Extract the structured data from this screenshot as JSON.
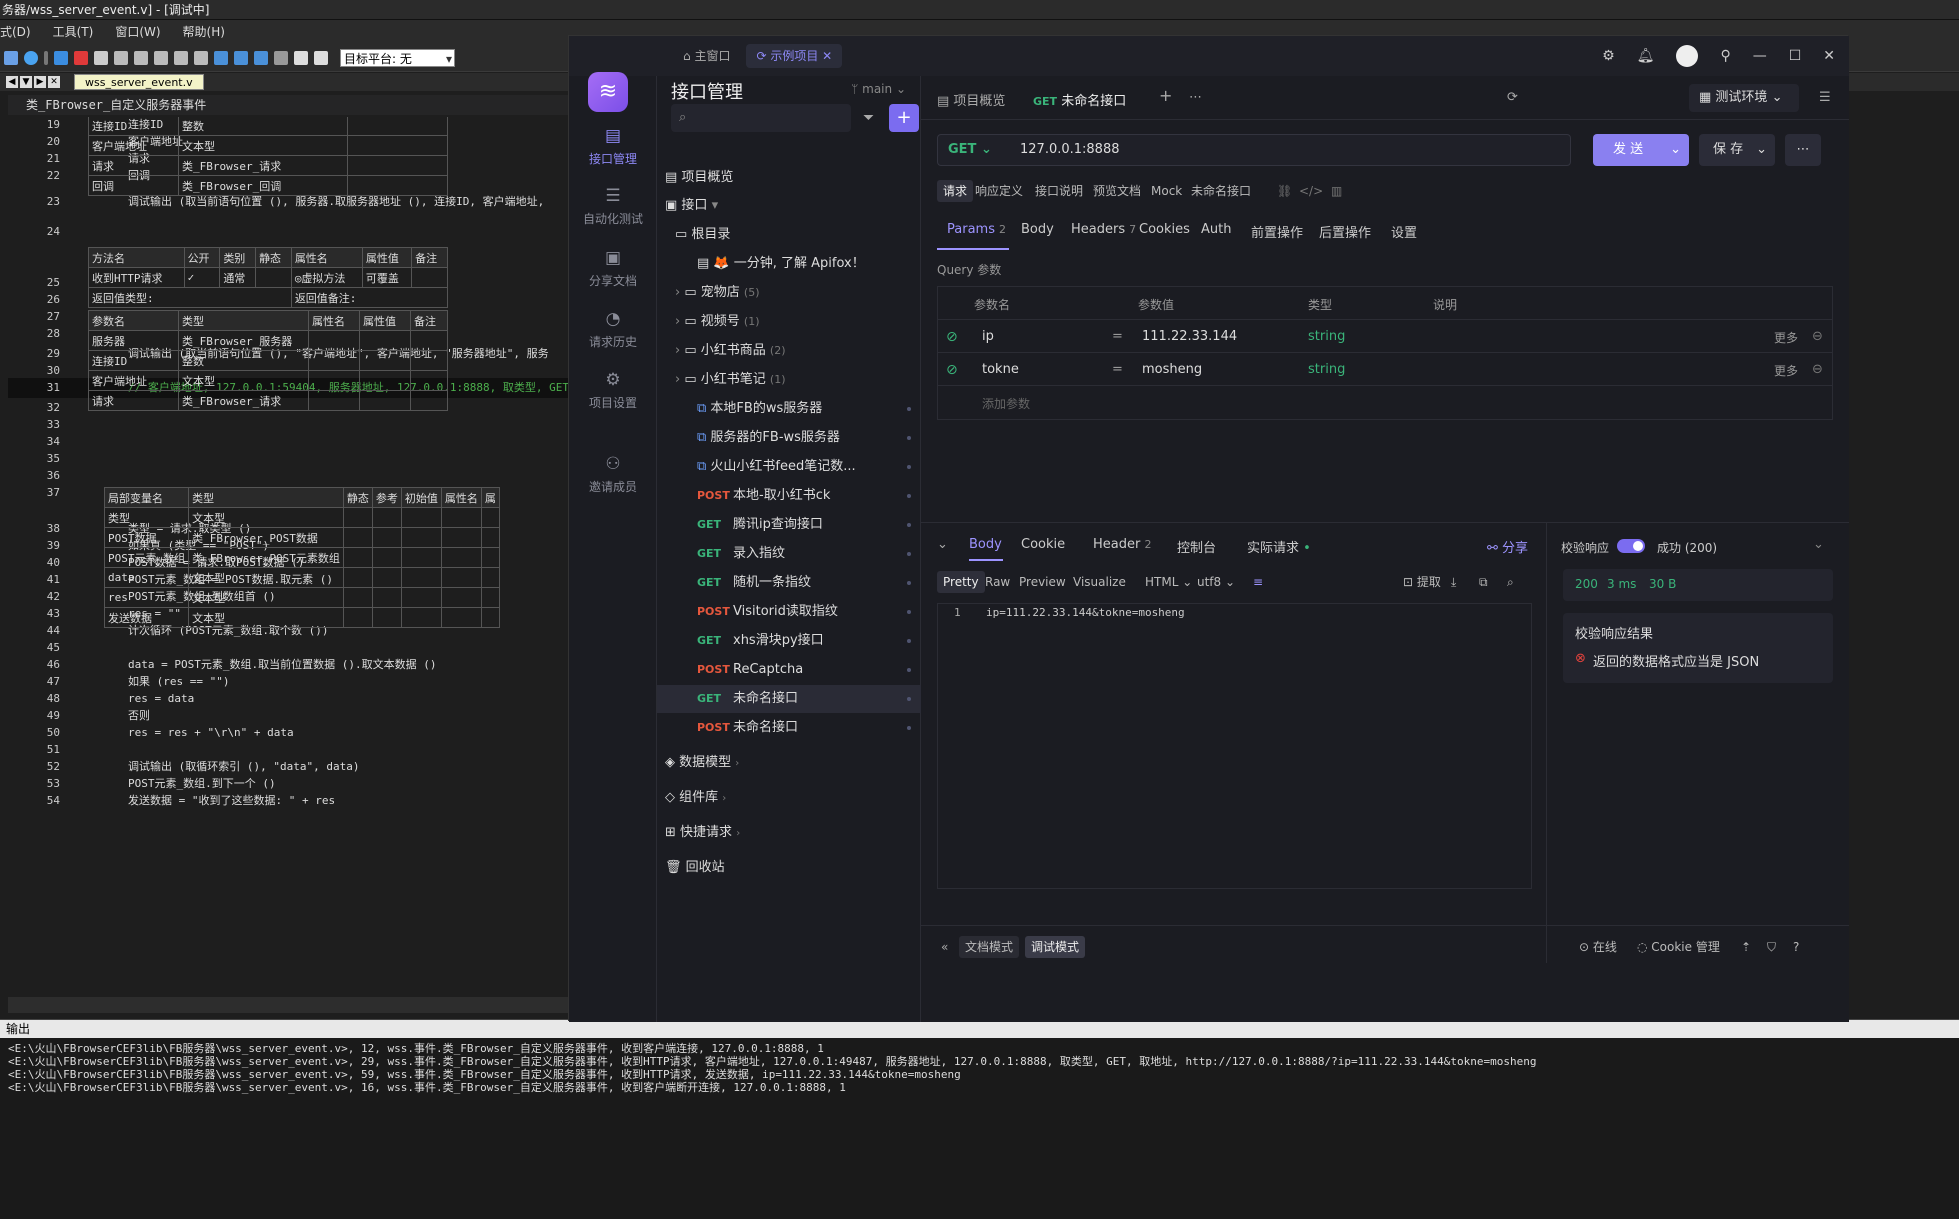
{
  "ide": {
    "title": "务器/wss_server_event.v] - [调试中]",
    "menu": [
      "式(D)",
      "工具(T)",
      "窗口(W)",
      "帮助(H)"
    ],
    "target_platform": "目标平台: 无",
    "file_tab": "wss_server_event.v",
    "sub_header": "类_FBrowser_自定义服务器事件",
    "lines": [
      {
        "n": "19",
        "text": "连接ID"
      },
      {
        "n": "20",
        "text": "客户端地址"
      },
      {
        "n": "21",
        "text": "请求"
      },
      {
        "n": "22",
        "text": "回调"
      },
      {
        "n": "23",
        "text": "调试输出 (取当前语句位置 (), 服务器.取服务器地址 (), 连接ID, 客户端地址,"
      },
      {
        "n": "24",
        "text": ""
      },
      {
        "n": "25",
        "text": ""
      },
      {
        "n": "26",
        "text": ""
      },
      {
        "n": "27",
        "text": ""
      },
      {
        "n": "28",
        "text": ""
      },
      {
        "n": "29",
        "text": "调试输出 (取当前语句位置 (), \"客户端地址\", 客户端地址, \"服务器地址\", 服务"
      },
      {
        "n": "30",
        "text": ""
      },
      {
        "n": "31",
        "text": "// 客户端地址, 127.0.0.1:59404, 服务器地址, 127.0.0.1:8888, 取类型, GET,"
      },
      {
        "n": "32",
        "text": ""
      },
      {
        "n": "33",
        "text": ""
      },
      {
        "n": "34",
        "text": ""
      },
      {
        "n": "35",
        "text": ""
      },
      {
        "n": "36",
        "text": ""
      },
      {
        "n": "37",
        "text": ""
      },
      {
        "n": "38",
        "text": "类型 = 请求.取类型 ()"
      },
      {
        "n": "39",
        "text": "如果真 (类型 == \"POST\")"
      },
      {
        "n": "40",
        "text": "  POST数据 = 请求.取POST数据 ()"
      },
      {
        "n": "41",
        "text": "  POST元素_数组 = POST数据.取元素 ()"
      },
      {
        "n": "42",
        "text": "  POST元素_数组.到数组首 ()"
      },
      {
        "n": "43",
        "text": "  res = \"\""
      },
      {
        "n": "44",
        "text": "  计次循环 (POST元素_数组.取个数 ())"
      },
      {
        "n": "45",
        "text": ""
      },
      {
        "n": "46",
        "text": "    data = POST元素_数组.取当前位置数据 ().取文本数据 ()"
      },
      {
        "n": "47",
        "text": "    如果 (res == \"\")"
      },
      {
        "n": "48",
        "text": "      res = data"
      },
      {
        "n": "49",
        "text": "    否则"
      },
      {
        "n": "50",
        "text": "      res = res + \"\\r\\n\" + data"
      },
      {
        "n": "51",
        "text": ""
      },
      {
        "n": "52",
        "text": "    调试输出 (取循环索引 (), \"data\", data)"
      },
      {
        "n": "53",
        "text": "    POST元素_数组.到下一个 ()"
      },
      {
        "n": "54",
        "text": "  发送数据 = \"收到了这些数据: \" + res"
      }
    ],
    "params_table": [
      [
        "连接ID",
        "整数"
      ],
      [
        "客户端地址",
        "文本型"
      ],
      [
        "请求",
        "类_FBrowser_请求"
      ],
      [
        "回调",
        "类_FBrowser_回调"
      ]
    ],
    "method_table": {
      "headers": [
        "方法名",
        "公开",
        "类别",
        "静态",
        "属性名",
        "属性值",
        "备注"
      ],
      "row": [
        "收到HTTP请求",
        "✓",
        "通常",
        "",
        "◎虚拟方法",
        "可覆盖",
        ""
      ],
      "return_type": "返回值类型:",
      "return_note": "返回值备注:"
    },
    "param_table2": {
      "headers": [
        "参数名",
        "类型",
        "属性名",
        "属性值",
        "备注"
      ],
      "rows": [
        [
          "服务器",
          "类_FBrowser_服务器"
        ],
        [
          "连接ID",
          "整数"
        ],
        [
          "客户端地址",
          "文本型"
        ],
        [
          "请求",
          "类_FBrowser_请求"
        ]
      ]
    },
    "local_table": {
      "headers": [
        "局部变量名",
        "类型",
        "静态",
        "参考",
        "初始值",
        "属性名",
        "属"
      ],
      "rows": [
        [
          "类型",
          "文本型"
        ],
        [
          "POST数据",
          "类_FBrowser_POST数据"
        ],
        [
          "POST元素_数组",
          "类_FBrowser_POST元素数组"
        ],
        [
          "data",
          "文本型"
        ],
        [
          "res",
          "文本型"
        ],
        [
          "发送数据",
          "文本型"
        ]
      ]
    },
    "output_title": "输出",
    "output_lines": [
      "<E:\\火山\\FBrowserCEF3lib\\FB服务器\\wss_server_event.v>, 12, wss.事件.类_FBrowser_自定义服务器事件, 收到客户端连接, 127.0.0.1:8888, 1",
      "<E:\\火山\\FBrowserCEF3lib\\FB服务器\\wss_server_event.v>, 29, wss.事件.类_FBrowser_自定义服务器事件, 收到HTTP请求, 客户端地址, 127.0.0.1:49487, 服务器地址, 127.0.0.1:8888, 取类型, GET, 取地址, http://127.0.0.1:8888/?ip=111.22.33.144&tokne=mosheng",
      "<E:\\火山\\FBrowserCEF3lib\\FB服务器\\wss_server_event.v>, 59, wss.事件.类_FBrowser_自定义服务器事件, 收到HTTP请求, 发送数据, ip=111.22.33.144&tokne=mosheng",
      "<E:\\火山\\FBrowserCEF3lib\\FB服务器\\wss_server_event.v>, 16, wss.事件.类_FBrowser_自定义服务器事件, 收到客户端断开连接, 127.0.0.1:8888, 1"
    ]
  },
  "apifox": {
    "window_tabs": [
      "主窗口",
      "示例项目"
    ],
    "rail": [
      "接口管理",
      "自动化测试",
      "分享文档",
      "请求历史",
      "项目设置",
      "邀请成员"
    ],
    "panel_title": "接口管理",
    "branch": "main",
    "tree": {
      "overview": "项目概览",
      "api_folder": "接口",
      "root": "根目录",
      "items": [
        {
          "label": "🦊 一分钟, 了解 Apifox！",
          "type": "doc"
        },
        {
          "label": "宠物店",
          "count": "(5)",
          "type": "folder"
        },
        {
          "label": "视频号",
          "count": "(1)",
          "type": "folder"
        },
        {
          "label": "小红书商品",
          "count": "(2)",
          "type": "folder"
        },
        {
          "label": "小红书笔记",
          "count": "(1)",
          "type": "folder"
        },
        {
          "label": "本地FB的ws服务器",
          "type": "ws"
        },
        {
          "label": "服务器的FB-ws服务器",
          "type": "ws"
        },
        {
          "label": "火山小红书feed笔记数...",
          "type": "ws"
        },
        {
          "label": "本地-取小红书ck",
          "method": "POST"
        },
        {
          "label": "腾讯ip查询接口",
          "method": "GET"
        },
        {
          "label": "录入指纹",
          "method": "GET"
        },
        {
          "label": "随机一条指纹",
          "method": "GET"
        },
        {
          "label": "Visitorid读取指纹",
          "method": "POST"
        },
        {
          "label": "xhs滑块py接口",
          "method": "GET"
        },
        {
          "label": "ReCaptcha",
          "method": "POST"
        },
        {
          "label": "未命名接口",
          "method": "GET"
        },
        {
          "label": "未命名接口",
          "method": "POST"
        }
      ],
      "bottom": [
        "数据模型",
        "组件库",
        "快捷请求",
        "回收站"
      ]
    },
    "tabs": [
      "项目概览",
      "未命名接口"
    ],
    "active_tab_method": "GET",
    "env": "测试环境",
    "request": {
      "method": "GET",
      "url": "127.0.0.1:8888",
      "send": "发 送",
      "save": "保 存"
    },
    "sub_tabs": [
      "请求",
      "响应定义",
      "接口说明",
      "预览文档",
      "Mock",
      "未命名接口"
    ],
    "param_tabs": [
      {
        "label": "Params",
        "n": "2"
      },
      {
        "label": "Body"
      },
      {
        "label": "Headers",
        "n": "7"
      },
      {
        "label": "Cookies"
      },
      {
        "label": "Auth"
      },
      {
        "label": "前置操作"
      },
      {
        "label": "后置操作"
      },
      {
        "label": "设置"
      }
    ],
    "query_label": "Query 参数",
    "param_headers": [
      "参数名",
      "参数值",
      "类型",
      "说明"
    ],
    "params": [
      {
        "name": "ip",
        "value": "111.22.33.144",
        "type": "string"
      },
      {
        "name": "tokne",
        "value": "mosheng",
        "type": "string"
      }
    ],
    "more": "更多",
    "add_param": "添加参数",
    "resp_tabs": [
      "Body",
      "Cookie",
      "Header",
      "控制台",
      "实际请求"
    ],
    "header_count": "2",
    "share": "分享",
    "view_tabs": [
      "Pretty",
      "Raw",
      "Preview",
      "Visualize",
      "HTML",
      "utf8"
    ],
    "extract": "提取",
    "resp_line_no": "1",
    "resp_text": "ip=111.22.33.144&tokne=mosheng",
    "validate_label": "校验响应",
    "validate_status": "成功 (200)",
    "stats": [
      "200",
      "3 ms",
      "30 B"
    ],
    "validate_result_title": "校验响应结果",
    "validate_error": "返回的数据格式应当是 JSON",
    "status_bar": {
      "doc_mode": "文档模式",
      "debug_mode": "调试模式",
      "online": "在线",
      "cookie": "Cookie 管理"
    },
    "colors": {
      "accent": "#8a80f0",
      "get": "#3ab47a",
      "post": "#e5573d"
    }
  }
}
